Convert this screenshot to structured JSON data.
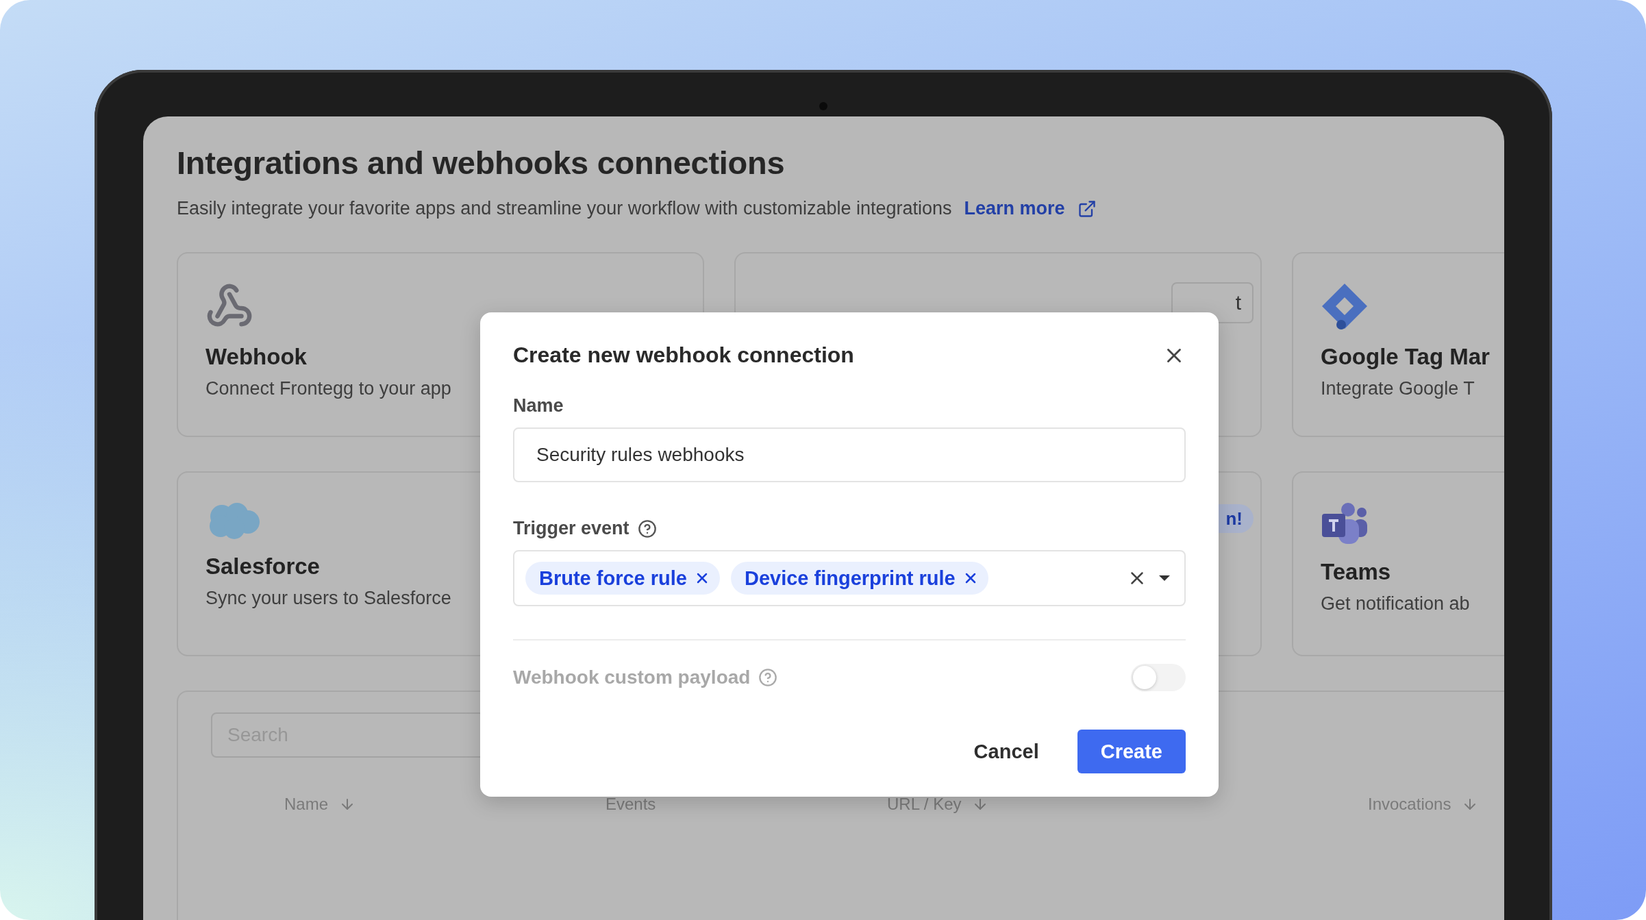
{
  "page": {
    "title": "Integrations and webhooks connections",
    "subtitle": "Easily integrate your favorite apps and streamline your workflow with customizable integrations",
    "learn_more": "Learn more"
  },
  "cards": [
    {
      "kind": "webhook",
      "title": "Webhook",
      "description": "Connect Frontegg to your app"
    },
    {
      "kind": "blank",
      "button": "t"
    },
    {
      "kind": "tag-manager",
      "title": "Google Tag Mar",
      "description": "Integrate Google T"
    },
    {
      "kind": "salesforce",
      "title": "Salesforce",
      "description": "Sync your users to Salesforce"
    },
    {
      "kind": "blank",
      "badge": "n!"
    },
    {
      "kind": "teams",
      "title": "Teams",
      "description": "Get notification ab"
    }
  ],
  "table": {
    "search": {
      "placeholder": "Search"
    },
    "columns": [
      {
        "label": "Name",
        "sortable": true
      },
      {
        "label": "Events",
        "sortable": false
      },
      {
        "label": "URL / Key",
        "sortable": true
      },
      {
        "label": "Invocations",
        "sortable": true
      }
    ]
  },
  "dialog": {
    "title": "Create new webhook connection",
    "name_label": "Name",
    "name_value": "Security rules webhooks",
    "trigger_label": "Trigger event",
    "trigger_events": [
      {
        "label": "Brute force rule"
      },
      {
        "label": "Device fingerprint rule"
      }
    ],
    "payload": {
      "label": "Webhook custom payload",
      "on": false,
      "disabled": true
    },
    "buttons": {
      "cancel": "Cancel",
      "create": "Create"
    }
  }
}
